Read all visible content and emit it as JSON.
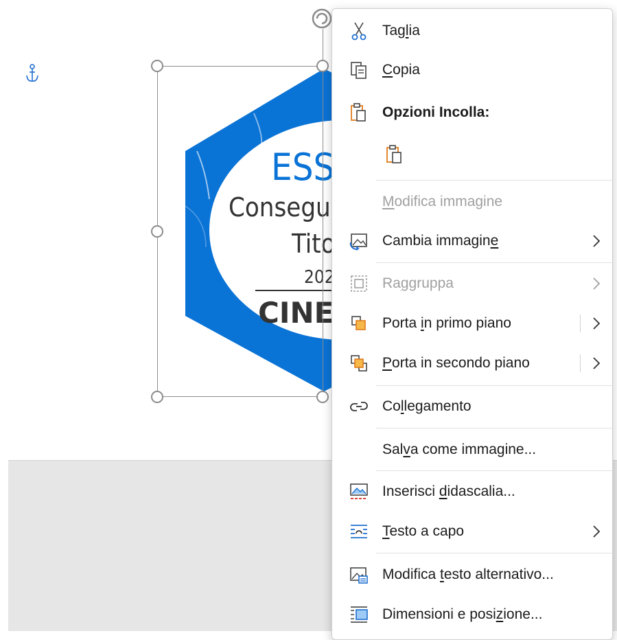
{
  "document": {
    "badge_text": {
      "line1": "ESS",
      "line2": "Consegu",
      "line3": "Tito",
      "line4": "202",
      "line5": "CINE"
    },
    "colors": {
      "badge_blue": "#0a73d6",
      "badge_text_dark": "#333333",
      "badge_text_blue": "#0a73d6"
    }
  },
  "menu": {
    "items": {
      "cut": {
        "pre": "Tag",
        "ul": "l",
        "post": "ia"
      },
      "copy": {
        "pre": "",
        "ul": "C",
        "post": "opia"
      },
      "paste_options": "Opzioni Incolla:",
      "edit_image": {
        "pre": "",
        "ul": "M",
        "post": "odifica immagine"
      },
      "change_image": {
        "pre": "Cambia immagin",
        "ul": "e",
        "post": ""
      },
      "group": {
        "pre": "Ra",
        "ul": "g",
        "post": "gruppa"
      },
      "bring_forward": {
        "pre": "Porta ",
        "ul": "i",
        "post": "n primo piano"
      },
      "send_backward": {
        "pre": "",
        "ul": "P",
        "post": "orta in secondo piano"
      },
      "link": {
        "pre": "Co",
        "ul": "l",
        "post": "legamento"
      },
      "save_as_image": {
        "pre": "Sal",
        "ul": "v",
        "post": "a come immagine..."
      },
      "insert_caption": {
        "pre": "Inserisci ",
        "ul": "d",
        "post": "idascalia..."
      },
      "wrap_text": {
        "pre": "",
        "ul": "T",
        "post": "esto a capo"
      },
      "edit_alt_text": {
        "pre": "Modifica ",
        "ul": "t",
        "post": "esto alternativo..."
      },
      "size_position": {
        "pre": "Dimensioni e posi",
        "ul": "z",
        "post": "ione..."
      }
    }
  }
}
